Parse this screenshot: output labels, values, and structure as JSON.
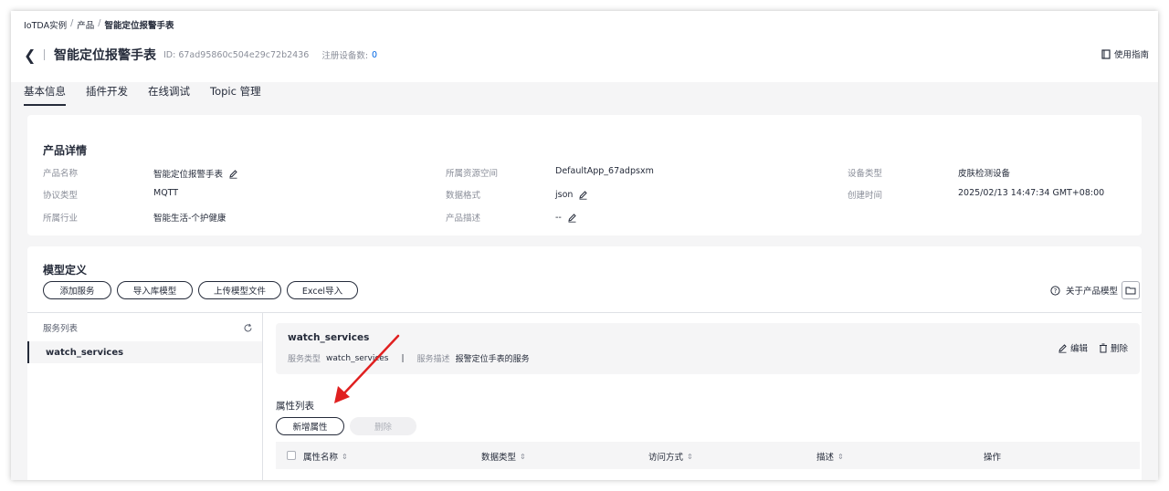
{
  "breadcrumb": {
    "items": [
      "IoTDA实例",
      "产品",
      "智能定位报警手表"
    ]
  },
  "header": {
    "title": "智能定位报警手表",
    "id_text": "ID: 67ad95860c504e29c72b2436",
    "registered_label": "注册设备数:",
    "registered_count": "0",
    "guide_label": "使用指南"
  },
  "tabs": [
    "基本信息",
    "插件开发",
    "在线调试",
    "Topic 管理"
  ],
  "details": {
    "title": "产品详情",
    "fields": [
      {
        "label": "产品名称",
        "value": "智能定位报警手表"
      },
      {
        "label": "协议类型",
        "value": "MQTT"
      },
      {
        "label": "所属行业",
        "value": "智能生活-个护健康"
      },
      {
        "label": "所属资源空间",
        "value": "DefaultApp_67adpsxm"
      },
      {
        "label": "数据格式",
        "value": "json"
      },
      {
        "label": "产品描述",
        "value": "--"
      },
      {
        "label": "设备类型",
        "value": "皮肤检测设备"
      },
      {
        "label": "创建时间",
        "value": "2025/02/13 14:47:34 GMT+08:00"
      }
    ]
  },
  "model": {
    "title": "模型定义",
    "buttons": [
      "添加服务",
      "导入库模型",
      "上传模型文件",
      "Excel导入"
    ],
    "about_label": "关于产品模型",
    "service_list_label": "服务列表",
    "service_item": "watch_services",
    "service": {
      "name": "watch_services",
      "type_label": "服务类型",
      "type_value": "watch_services",
      "desc_label": "服务描述",
      "desc_value": "报警定位手表的服务",
      "edit_label": "编辑",
      "delete_label": "删除"
    },
    "props": {
      "title": "属性列表",
      "add_label": "新增属性",
      "delete_label": "删除",
      "columns": [
        "属性名称",
        "数据类型",
        "访问方式",
        "描述",
        "操作"
      ]
    }
  },
  "colors": {
    "accent": "#0066e4",
    "annotation_arrow": "#e02020"
  }
}
